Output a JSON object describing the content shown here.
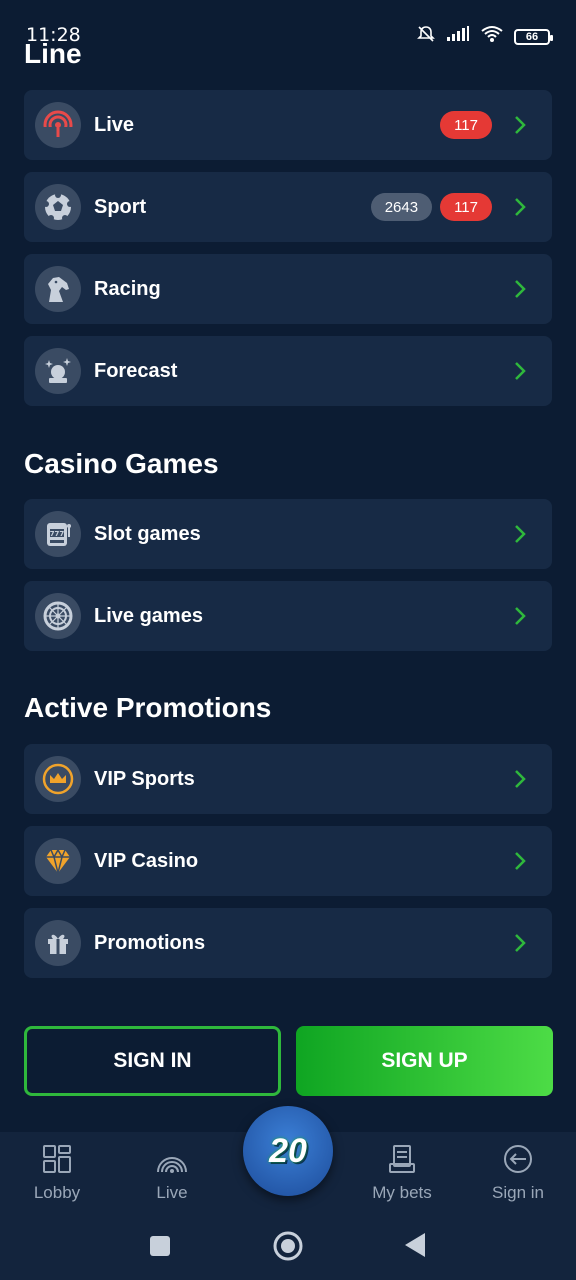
{
  "status_bar": {
    "time": "11:28",
    "battery": "66"
  },
  "page": {
    "title": "Line"
  },
  "line_items": [
    {
      "label": "Live",
      "icon": "live-signal-icon",
      "badges": [
        {
          "text": "117",
          "color": "red"
        }
      ]
    },
    {
      "label": "Sport",
      "icon": "soccer-ball-icon",
      "badges": [
        {
          "text": "2643",
          "color": "gray"
        },
        {
          "text": "117",
          "color": "red"
        }
      ]
    },
    {
      "label": "Racing",
      "icon": "horse-icon",
      "badges": []
    },
    {
      "label": "Forecast",
      "icon": "crystal-ball-icon",
      "badges": []
    }
  ],
  "casino": {
    "title": "Casino Games",
    "items": [
      {
        "label": "Slot games",
        "icon": "slot-machine-icon"
      },
      {
        "label": "Live games",
        "icon": "roulette-icon"
      }
    ]
  },
  "promotions": {
    "title": "Active Promotions",
    "items": [
      {
        "label": "VIP Sports",
        "icon": "crown-icon"
      },
      {
        "label": "VIP Casino",
        "icon": "diamond-icon"
      },
      {
        "label": "Promotions",
        "icon": "gift-icon"
      }
    ]
  },
  "auth": {
    "sign_in": "SIGN IN",
    "sign_up": "SIGN UP"
  },
  "bottom_nav": {
    "items": [
      {
        "label": "Lobby",
        "icon": "grid-icon"
      },
      {
        "label": "Live",
        "icon": "live-signal-icon"
      },
      {
        "label": "My bets",
        "icon": "receipt-icon"
      },
      {
        "label": "Sign in",
        "icon": "sign-in-icon"
      }
    ],
    "center_label": "20"
  },
  "colors": {
    "background": "#0c1c33",
    "card": "#172a45",
    "accent_green": "#2fb83c",
    "badge_red": "#e53935",
    "badge_gray": "#4e5d73"
  }
}
